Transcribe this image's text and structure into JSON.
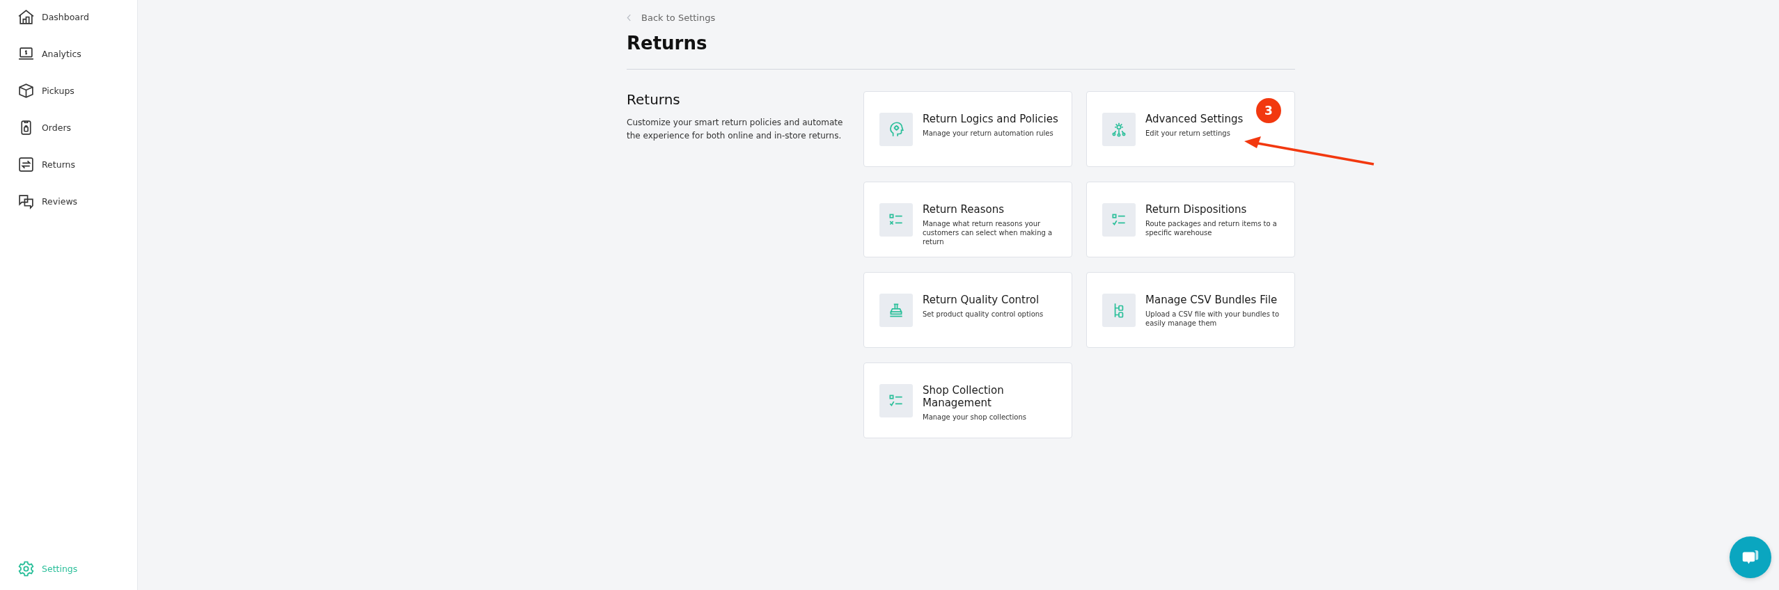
{
  "sidebar": {
    "items": [
      {
        "label": "Dashboard",
        "selected": false
      },
      {
        "label": "Analytics",
        "selected": false
      },
      {
        "label": "Pickups",
        "selected": false
      },
      {
        "label": "Orders",
        "selected": false
      },
      {
        "label": "Returns",
        "selected": false
      },
      {
        "label": "Reviews",
        "selected": false
      }
    ],
    "footer_item": {
      "label": "Settings",
      "selected": true
    }
  },
  "back_link": "Back to Settings",
  "page_title": "Returns",
  "section": {
    "title": "Returns",
    "description": "Customize your smart return policies and automate the experience for both online and in-store returns."
  },
  "cards": [
    {
      "title": "Return Logics and Policies",
      "description": "Manage your return automation rules"
    },
    {
      "title": "Advanced Settings",
      "description": "Edit your return settings"
    },
    {
      "title": "Return Reasons",
      "description": "Manage what return reasons your customers can select when making a return"
    },
    {
      "title": "Return Dispositions",
      "description": "Route packages and return items to a specific warehouse"
    },
    {
      "title": "Return Quality Control",
      "description": "Set product quality control options"
    },
    {
      "title": "Manage CSV Bundles File",
      "description": "Upload a CSV file with your bundles to easily manage them"
    },
    {
      "title": "Shop Collection Management",
      "description": "Manage your shop collections"
    }
  ],
  "annotation": {
    "badge": "3"
  }
}
